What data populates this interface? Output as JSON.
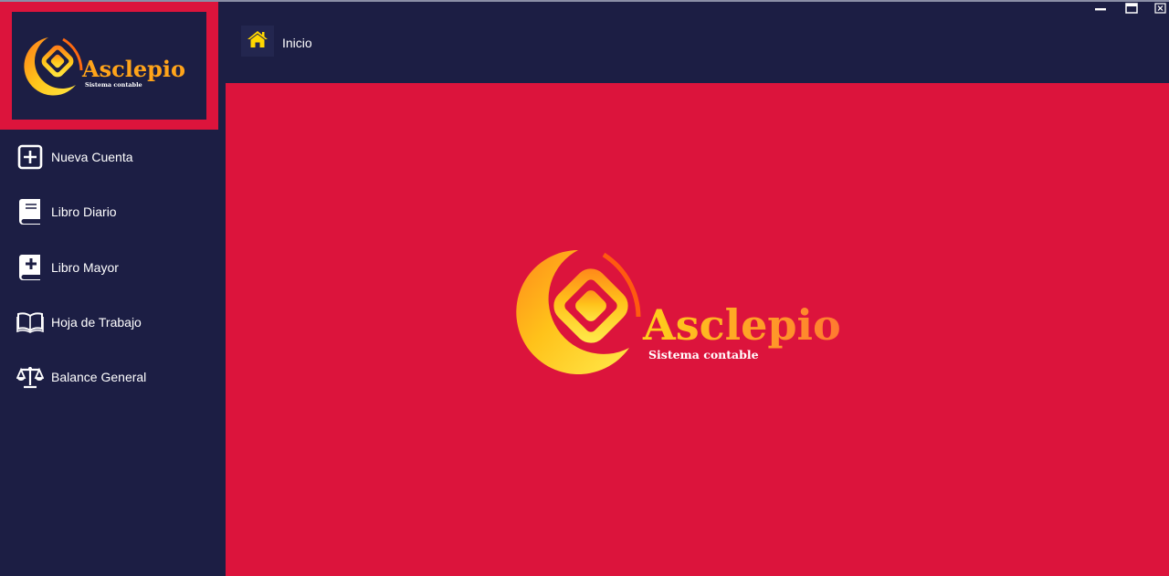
{
  "window": {
    "controls": {
      "minimize_icon": "minimize-icon",
      "maximize_icon": "maximize-icon",
      "close_icon": "close-icon"
    }
  },
  "sidebar": {
    "logo": {
      "title": "Asclepio",
      "subtitle": "Sistema contable"
    },
    "items": [
      {
        "label": "Nueva Cuenta",
        "icon": "plus-square-icon"
      },
      {
        "label": "Libro Diario",
        "icon": "book-icon"
      },
      {
        "label": "Libro Mayor",
        "icon": "medical-book-icon"
      },
      {
        "label": "Hoja de Trabajo",
        "icon": "open-book-icon"
      },
      {
        "label": "Balance General",
        "icon": "balance-scale-icon"
      }
    ]
  },
  "header": {
    "home_icon": "home-icon",
    "breadcrumb": "Inicio"
  },
  "main": {
    "logo": {
      "title": "Asclepio",
      "subtitle": "Sistema contable"
    }
  },
  "colors": {
    "sidebar_bg": "#1c1e44",
    "accent_red": "#dc143c",
    "logo_gold": "#ffb020",
    "home_icon_yellow": "#ffd700",
    "text": "#ffffff"
  }
}
